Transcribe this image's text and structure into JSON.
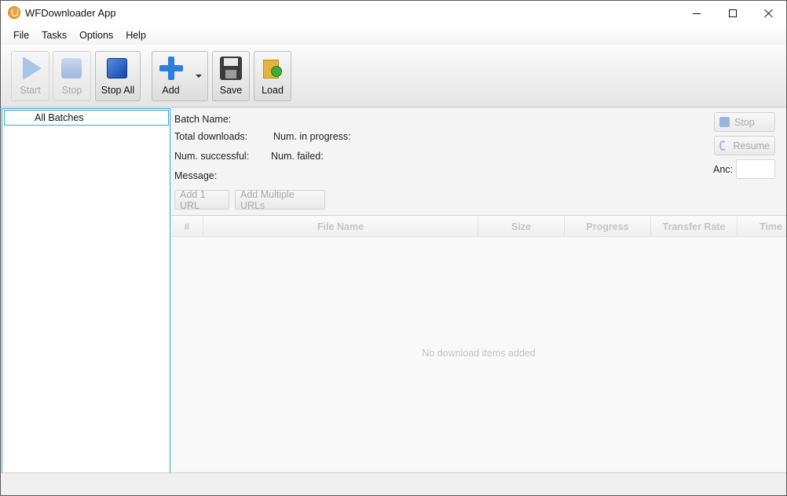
{
  "window": {
    "title": "WFDownloader App"
  },
  "menu": {
    "items": [
      "File",
      "Tasks",
      "Options",
      "Help"
    ]
  },
  "toolbar": {
    "start_label": "Start",
    "stop_label": "Stop",
    "stop_all_label": "Stop All",
    "add_label": "Add",
    "save_label": "Save",
    "load_label": "Load"
  },
  "tree": {
    "items": [
      "All Batches"
    ]
  },
  "details": {
    "batch_name_label": "Batch Name:",
    "total_downloads_label": "Total downloads:",
    "num_in_progress_label": "Num. in progress:",
    "num_successful_label": "Num. successful:",
    "num_failed_label": "Num. failed:",
    "message_label": "Message:",
    "add_one_url_label": "Add 1 URL",
    "add_multiple_urls_label": "Add Multiple URLs",
    "stop_label": "Stop",
    "resume_label": "Resume",
    "anc_label": "Anc:",
    "anc_value": ""
  },
  "table": {
    "columns": [
      "#",
      "File Name",
      "Size",
      "Progress",
      "Transfer Rate",
      "Time"
    ],
    "empty_message": "No download items added"
  }
}
